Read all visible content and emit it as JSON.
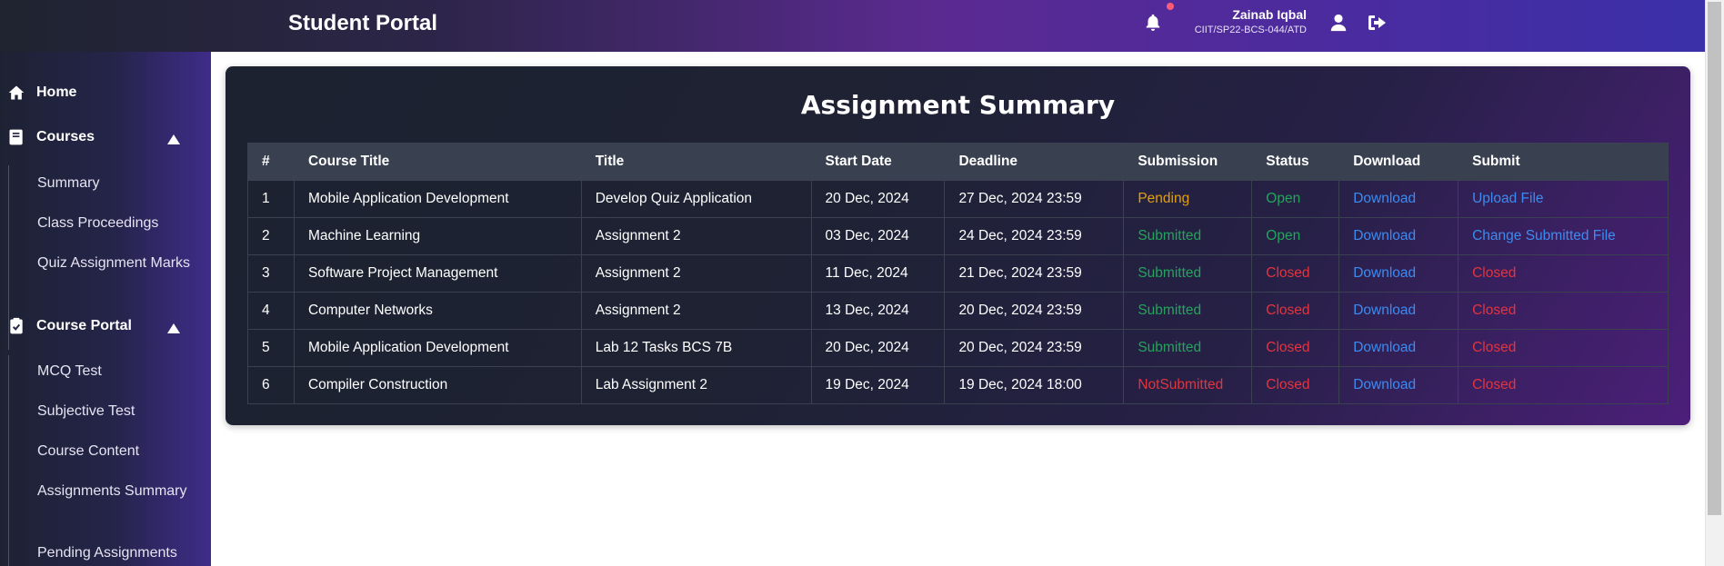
{
  "header": {
    "brand": "Student Portal",
    "user_name": "Zainab Iqbal",
    "user_id": "CIIT/SP22-BCS-044/ATD"
  },
  "sidebar": {
    "home": "Home",
    "courses": "Courses",
    "courses_items": [
      "Summary",
      "Class Proceedings",
      "Quiz Assignment Marks"
    ],
    "course_portal": "Course Portal",
    "portal_items": [
      "MCQ Test",
      "Subjective Test",
      "Course Content",
      "Assignments Summary",
      "Pending Assignments"
    ]
  },
  "main": {
    "title": "Assignment Summary",
    "columns": [
      "#",
      "Course Title",
      "Title",
      "Start Date",
      "Deadline",
      "Submission",
      "Status",
      "Download",
      "Submit"
    ],
    "rows": [
      {
        "num": "1",
        "course": "Mobile Application Development",
        "title": "Develop Quiz Application",
        "start": "20 Dec, 2024",
        "deadline": "27 Dec, 2024 23:59",
        "submission": "Pending",
        "status": "Open",
        "download": "Download",
        "submit": "Upload File"
      },
      {
        "num": "2",
        "course": "Machine Learning",
        "title": "Assignment 2",
        "start": "03 Dec, 2024",
        "deadline": "24 Dec, 2024 23:59",
        "submission": "Submitted",
        "status": "Open",
        "download": "Download",
        "submit": "Change Submitted File"
      },
      {
        "num": "3",
        "course": "Software Project Management",
        "title": "Assignment 2",
        "start": "11 Dec, 2024",
        "deadline": "21 Dec, 2024 23:59",
        "submission": "Submitted",
        "status": "Closed",
        "download": "Download",
        "submit": "Closed"
      },
      {
        "num": "4",
        "course": "Computer Networks",
        "title": "Assignment 2",
        "start": "13 Dec, 2024",
        "deadline": "20 Dec, 2024 23:59",
        "submission": "Submitted",
        "status": "Closed",
        "download": "Download",
        "submit": "Closed"
      },
      {
        "num": "5",
        "course": "Mobile Application Development",
        "title": "Lab 12 Tasks BCS 7B",
        "start": "20 Dec, 2024",
        "deadline": "20 Dec, 2024 23:59",
        "submission": "Submitted",
        "status": "Closed",
        "download": "Download",
        "submit": "Closed"
      },
      {
        "num": "6",
        "course": "Compiler Construction",
        "title": "Lab Assignment 2",
        "start": "19 Dec, 2024",
        "deadline": "19 Dec, 2024 18:00",
        "submission": "NotSubmitted",
        "status": "Closed",
        "download": "Download",
        "submit": "Closed"
      }
    ]
  },
  "colors": {
    "pending": "#e3a008",
    "submitted": "#22a55b",
    "closed": "#e3343f",
    "link": "#3d8bf0"
  },
  "icons": [
    "bell-icon",
    "user-icon",
    "logout-icon",
    "home-icon",
    "book-icon",
    "clipboard-check-icon",
    "chevron-up-icon"
  ]
}
